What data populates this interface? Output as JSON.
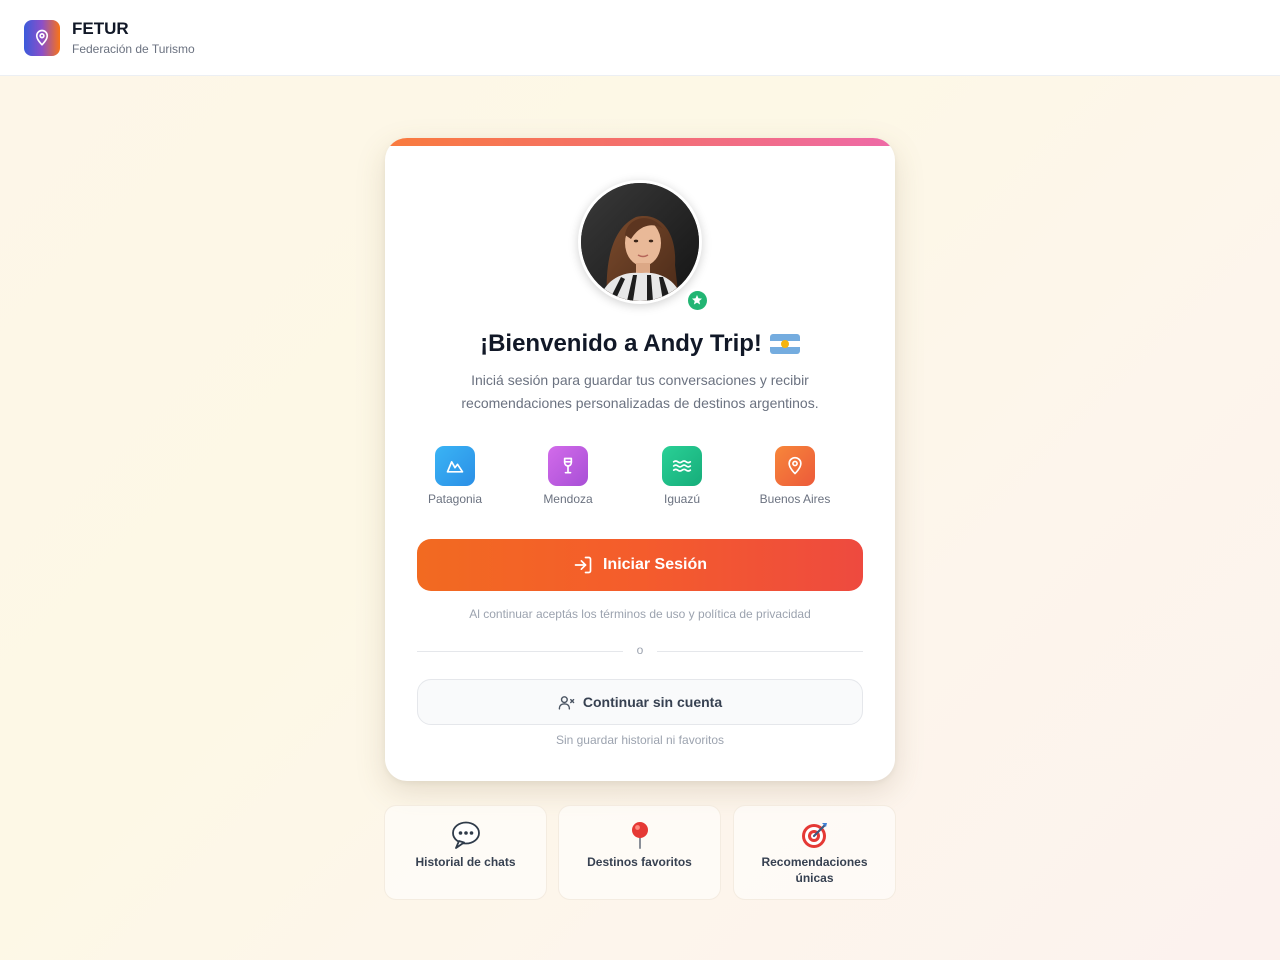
{
  "header": {
    "brand_name": "FETUR",
    "brand_subtitle": "Federación de Turismo",
    "logo_icon": "map-pin-icon"
  },
  "card": {
    "title": "¡Bienvenido a Andy Trip!",
    "title_flag": "argentina-flag",
    "subtitle": "Iniciá sesión para guardar tus conversaciones y recibir recomendaciones personalizadas de destinos argentinos.",
    "avatar_badge_icon": "star-badge-icon",
    "destinations": [
      {
        "label": "Patagonia",
        "icon": "mountain-icon",
        "color": "#35a8f0"
      },
      {
        "label": "Mendoza",
        "icon": "wine-glass-icon",
        "color": "#c35ce0"
      },
      {
        "label": "Iguazú",
        "icon": "waves-icon",
        "color": "#20c08a"
      },
      {
        "label": "Buenos Aires",
        "icon": "map-pin-icon",
        "color": "#f26a3a"
      }
    ],
    "login_button": "Iniciar Sesión",
    "terms": "Al continuar aceptás los términos de uso y política de privacidad",
    "divider": "o",
    "guest_button": "Continuar sin cuenta",
    "guest_note": "Sin guardar historial ni favoritos"
  },
  "features": [
    {
      "label": "Historial de chats",
      "icon": "speech-bubble-icon"
    },
    {
      "label": "Destinos favoritos",
      "icon": "pushpin-icon"
    },
    {
      "label": "Recomendaciones únicas",
      "icon": "target-icon"
    }
  ],
  "colors": {
    "accent": "#f26a21",
    "accent_end": "#ee4a3f",
    "badge": "#22b573"
  }
}
